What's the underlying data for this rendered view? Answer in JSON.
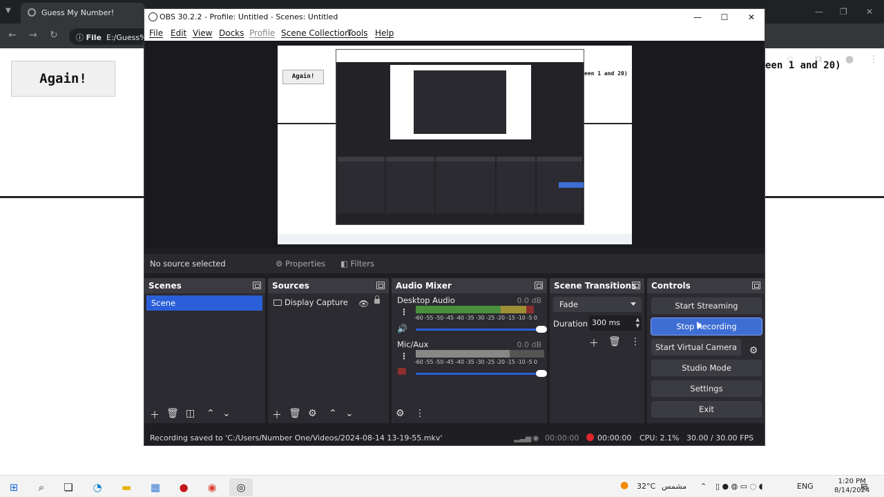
{
  "browser": {
    "tab_title": "Guess My Number!",
    "omnibox_scheme": "File",
    "omnibox_url": "E:/Guess%",
    "again_button": "Again!",
    "hint_text": "een 1 and 20)"
  },
  "obs": {
    "window_title": "OBS 30.2.2 - Profile: Untitled - Scenes: Untitled",
    "menu": [
      "File",
      "Edit",
      "View",
      "Docks",
      "Profile",
      "Scene Collection",
      "Tools",
      "Help"
    ],
    "no_source": "No source selected",
    "properties_label": "Properties",
    "filters_label": "Filters",
    "scenes": {
      "title": "Scenes",
      "items": [
        "Scene"
      ]
    },
    "sources": {
      "title": "Sources",
      "items": [
        "Display Capture"
      ]
    },
    "audio_mixer": {
      "title": "Audio Mixer",
      "channels": [
        {
          "name": "Desktop Audio",
          "db": "0.0 dB",
          "level": 0.92
        },
        {
          "name": "Mic/Aux",
          "db": "0.0 dB",
          "level": 0.73
        }
      ],
      "ticks": "-60 -55 -50 -45 -40 -35 -30 -25 -20 -15 -10  -5   0"
    },
    "transitions": {
      "title": "Scene Transitions",
      "selected": "Fade",
      "duration_label": "Duration",
      "duration_value": "300 ms"
    },
    "controls": {
      "title": "Controls",
      "start_streaming": "Start Streaming",
      "stop_recording": "Stop Recording",
      "start_virtual_camera": "Start Virtual Camera",
      "studio_mode": "Studio Mode",
      "settings": "Settings",
      "exit": "Exit"
    },
    "status": {
      "message": "Recording saved to 'C:/Users/Number One/Videos/2024-08-14 13-19-55.mkv'",
      "stream_time": "00:00:00",
      "rec_time": "00:00:00",
      "cpu": "CPU: 2.1%",
      "fps": "30.00 / 30.00 FPS"
    },
    "preview_again": "Again!",
    "preview_hint": "een 1 and 20)"
  },
  "taskbar": {
    "weather": "32°C",
    "weather_text": "مشمس",
    "lang": "ENG",
    "time": "1:20 PM",
    "date": "8/14/2024"
  },
  "colors": {
    "accent": "#2b5fd9",
    "active_button": "#3e6ed3",
    "record_red": "#e0252b"
  },
  "icons": [
    "windows-start-icon",
    "search-icon",
    "task-view-icon",
    "edge-icon",
    "file-explorer-icon",
    "store-icon",
    "app-red-icon",
    "chrome-icon",
    "obs-icon",
    "gear-icon",
    "eye-icon",
    "lock-icon",
    "speaker-icon",
    "mic-muted-icon",
    "plus-icon",
    "trash-icon",
    "arrow-up-icon",
    "arrow-down-icon",
    "kebab-icon"
  ]
}
